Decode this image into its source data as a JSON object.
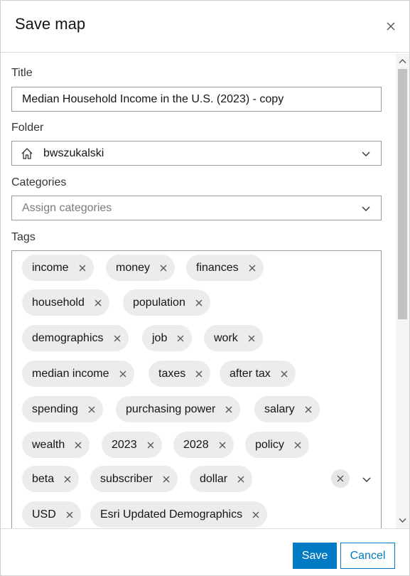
{
  "dialog": {
    "title": "Save map",
    "close_icon": "close-icon"
  },
  "form": {
    "title_label": "Title",
    "title_value": "Median Household Income in the U.S. (2023) - copy",
    "folder_label": "Folder",
    "folder_icon": "home-icon",
    "folder_value": "bwszukalski",
    "categories_label": "Categories",
    "categories_placeholder": "Assign categories",
    "tags_label": "Tags",
    "tags": [
      "income",
      "money",
      "finances",
      "household",
      "population",
      "demographics",
      "job",
      "work",
      "median income",
      "taxes",
      "after tax",
      "spending",
      "purchasing power",
      "salary",
      "wealth",
      "2023",
      "2028",
      "policy",
      "beta",
      "subscriber",
      "dollar",
      "USD",
      "Esri Updated Demographics"
    ]
  },
  "footer": {
    "save_label": "Save",
    "cancel_label": "Cancel"
  },
  "colors": {
    "accent": "#007ac2",
    "chip_bg": "#ececec"
  }
}
